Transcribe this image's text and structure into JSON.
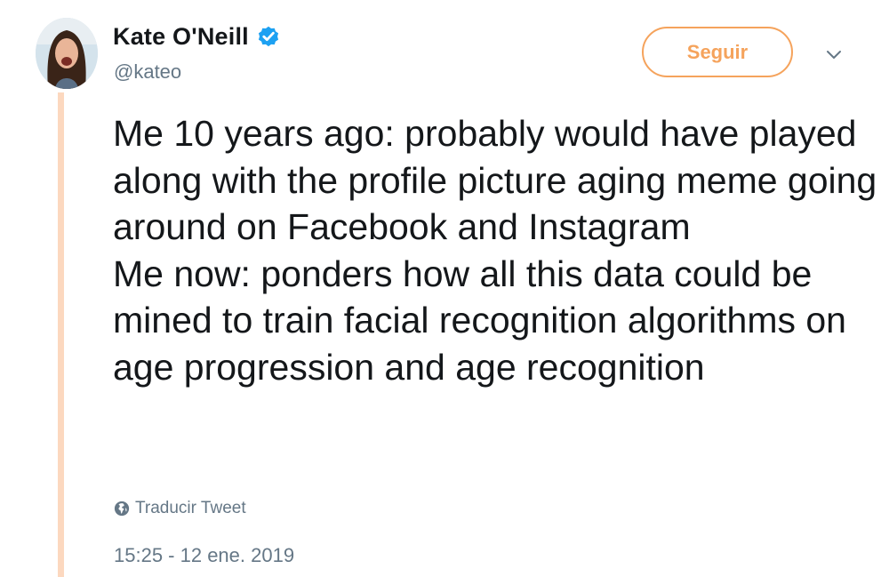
{
  "author": {
    "display_name": "Kate O'Neill",
    "handle": "@kateo",
    "verified": true
  },
  "follow_button": {
    "label": "Seguir"
  },
  "tweet": {
    "lines": [
      "Me 10 years ago: probably would have played along with the profile picture aging meme going around on Facebook and Instagram",
      "Me now: ponders how all this data could be mined to train facial recognition algorithms on age progression and age recognition"
    ],
    "translate_label": "Traducir Tweet",
    "timestamp": "15:25 - 12 ene. 2019"
  },
  "icons": {
    "verified": "verified-badge-icon",
    "caret": "chevron-down-icon",
    "translate": "globe-icon"
  },
  "colors": {
    "accent": "#f5a35c",
    "thread_line": "#fcd8bf",
    "verified_blue": "#1da1f2",
    "secondary_text": "#657786"
  }
}
